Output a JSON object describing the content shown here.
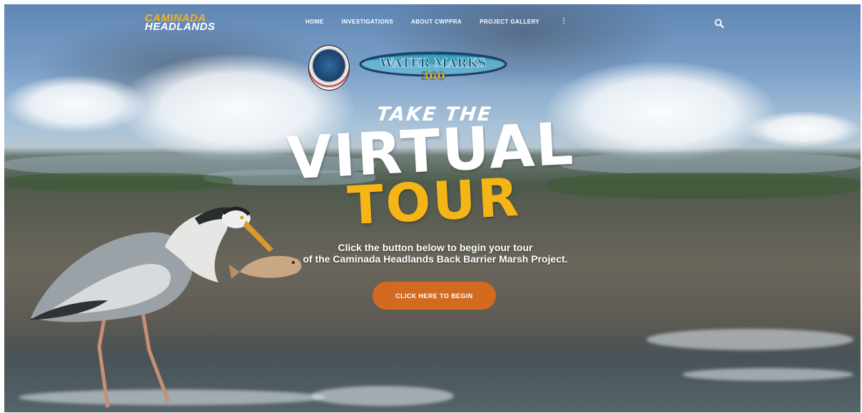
{
  "brand": {
    "line1": "CAMINADA",
    "line2": "HEADLANDS"
  },
  "nav": {
    "items": [
      "HOME",
      "INVESTIGATIONS",
      "ABOUT CWPPRA",
      "PROJECT GALLERY"
    ],
    "more": "⋮"
  },
  "icons": {
    "search": "search-icon",
    "more": "vertical-dots-icon"
  },
  "partner_logo": {
    "text_line1": "WATER MARKS",
    "text_line2": "360"
  },
  "hero": {
    "line1": "TAKE THE",
    "line2": "VIRTUAL",
    "line3": "TOUR",
    "subtitle_line1": "Click the button below to begin your tour",
    "subtitle_line2": "of the Caminada Headlands Back Barrier Marsh Project.",
    "cta": "CLICK HERE TO BEGIN"
  },
  "colors": {
    "accent_yellow": "#f6b516",
    "cta_orange": "#d26a1f"
  }
}
